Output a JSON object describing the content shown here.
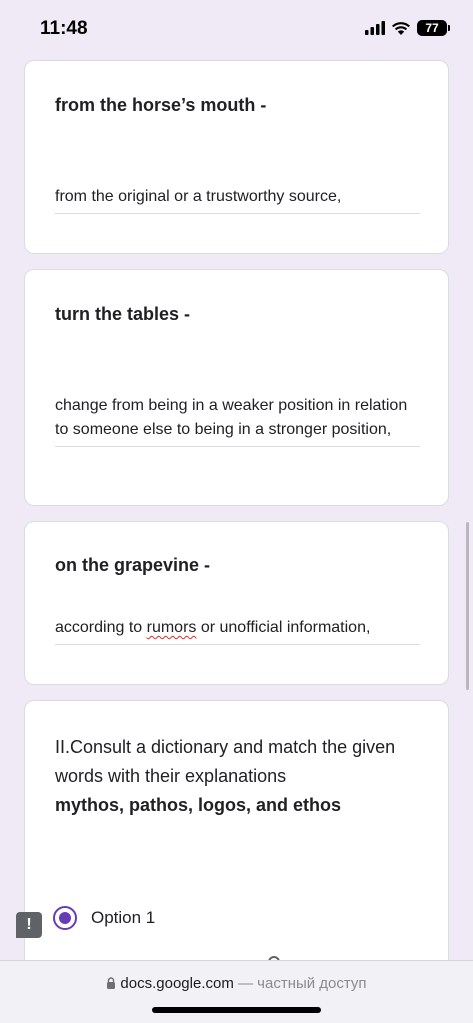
{
  "status_bar": {
    "time": "11:48",
    "battery": "77"
  },
  "cards": [
    {
      "title": "from the horse’s mouth -",
      "answer": "from the original or a trustworthy source,"
    },
    {
      "title": "turn the tables -",
      "answer": "change from being in a weaker position in relation to someone else to being in a stronger position,"
    },
    {
      "title": "on the grapevine -",
      "answer_before": "according to ",
      "answer_misspelled": "rumors",
      "answer_after": " or unofficial information,"
    }
  ],
  "question": {
    "text": "II.Consult a dictionary and match the given words with their explanations",
    "bold_text": "mythos, pathos, logos, and  ethos",
    "option_label": "Option 1"
  },
  "browser": {
    "domain": "docs.google.com",
    "note": " — частный доступ"
  }
}
